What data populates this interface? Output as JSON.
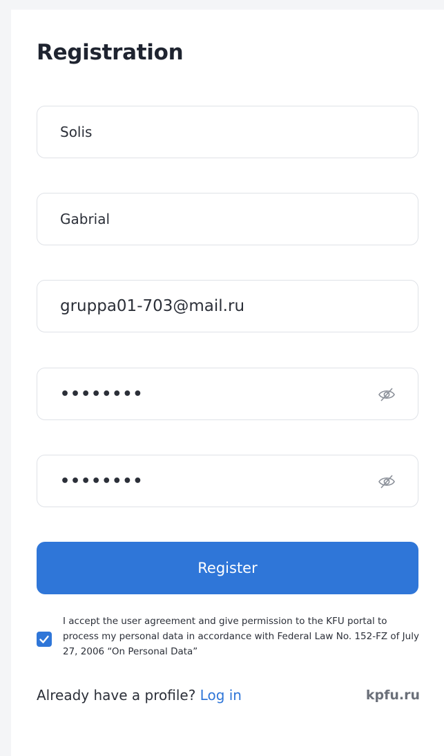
{
  "header": {
    "title": "Registration"
  },
  "form": {
    "last_name": "Solis",
    "first_name": "Gabrial",
    "email": "gruppa01-703@mail.ru",
    "password": "••••••••",
    "password_confirm": "••••••••",
    "password_icon": "eye-slash-icon",
    "submit_label": "Register"
  },
  "consent": {
    "checked": true,
    "text": "I accept the user agreement and give permission to the KFU portal to process my personal data in accordance with Federal Law No. 152-FZ of July 27, 2006 “On Personal Data”"
  },
  "footer": {
    "prompt": "Already have a profile?",
    "login_label": "Log in",
    "site": "kpfu.ru"
  },
  "colors": {
    "accent": "#2f76d8",
    "text": "#2b2f38",
    "border": "#dfe2e7",
    "muted": "#6b7079"
  }
}
